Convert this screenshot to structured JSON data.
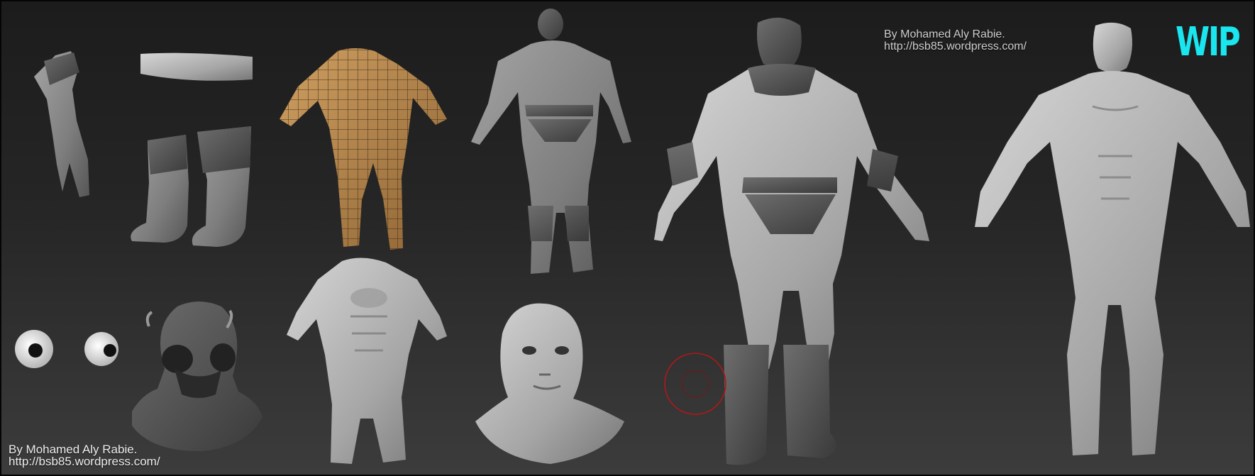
{
  "credits": {
    "top_line1": "By Mohamed Aly Rabie.",
    "top_line2": "http://bsb85.wordpress.com/",
    "bottom_line1": "By Mohamed Aly Rabie.",
    "bottom_line2": "http://bsb85.wordpress.com/"
  },
  "badge": {
    "label": "WIP",
    "color": "#19e6ee"
  },
  "sculpt_parts": [
    {
      "name": "hand"
    },
    {
      "name": "belt"
    },
    {
      "name": "boots"
    },
    {
      "name": "bodysuit-base-mesh"
    },
    {
      "name": "eyes"
    },
    {
      "name": "helmet"
    },
    {
      "name": "muscular-torso"
    },
    {
      "name": "head-bust"
    }
  ],
  "figures": [
    {
      "name": "dressed-figure-small"
    },
    {
      "name": "dressed-figure-large"
    },
    {
      "name": "anatomy-figure"
    }
  ],
  "colors": {
    "clay": "#8a8a8a",
    "base_mesh": "#b8884c",
    "brush_circle": "#b01818"
  }
}
